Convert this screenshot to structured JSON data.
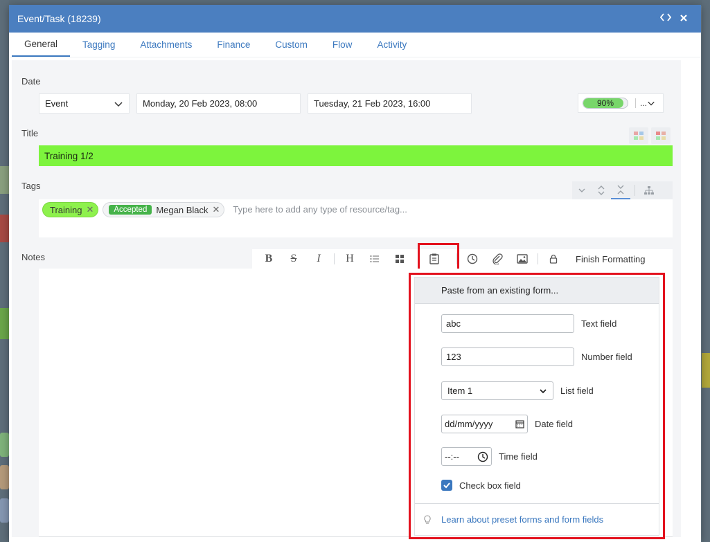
{
  "dialog": {
    "title": "Event/Task (18239)",
    "code_icon": "code-icon",
    "close_icon": "close-icon"
  },
  "tabs": [
    {
      "label": "General",
      "active": true
    },
    {
      "label": "Tagging"
    },
    {
      "label": "Attachments"
    },
    {
      "label": "Finance"
    },
    {
      "label": "Custom"
    },
    {
      "label": "Flow"
    },
    {
      "label": "Activity"
    }
  ],
  "date": {
    "label": "Date",
    "type_value": "Event",
    "start_value": "Monday, 20 Feb 2023, 08:00",
    "end_value": "Tuesday, 21 Feb 2023, 16:00",
    "progress_text": "90%",
    "progress_fraction": 0.9,
    "more_label": "..."
  },
  "title_section": {
    "label": "Title",
    "value": "Training 1/2",
    "bg_color": "#7df43d"
  },
  "tags": {
    "label": "Tags",
    "chips": [
      {
        "label": "Training",
        "color": "#8ef14d"
      },
      {
        "badge": "Accepted",
        "label": "Megan Black"
      }
    ],
    "placeholder": "Type here to add any type of resource/tag..."
  },
  "notes": {
    "label": "Notes",
    "finish_label": "Finish Formatting"
  },
  "popup": {
    "header": "Paste from an existing form...",
    "fields": {
      "text_value": "abc",
      "text_label": "Text field",
      "number_value": "123",
      "number_label": "Number field",
      "list_value": "Item 1",
      "list_label": "List field",
      "date_value": "dd/mm/yyyy",
      "date_label": "Date field",
      "time_value": "--:--",
      "time_label": "Time field",
      "checkbox_label": "Check box field"
    },
    "footer_link": "Learn about preset forms and form fields"
  },
  "colors": {
    "accent": "#3b78bf",
    "titlebar": "#4b7fc0",
    "highlight": "#e3121e",
    "accepted": "#46b34a"
  }
}
